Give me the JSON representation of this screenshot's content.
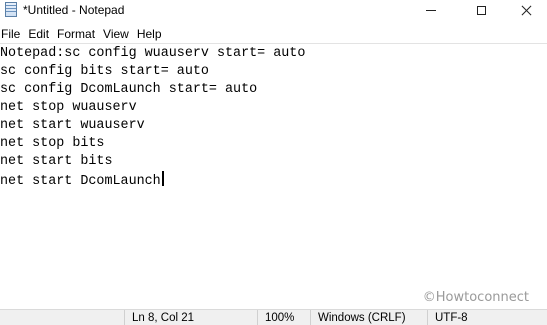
{
  "window": {
    "title": "*Untitled - Notepad",
    "app_icon": "notepad-icon"
  },
  "menu": {
    "items": [
      "File",
      "Edit",
      "Format",
      "View",
      "Help"
    ]
  },
  "editor": {
    "lines": [
      "Notepad:sc config wuauserv start= auto",
      "sc config bits start= auto",
      "sc config DcomLaunch start= auto",
      "net stop wuauserv",
      "net start wuauserv",
      "net stop bits",
      "net start bits",
      "net start DcomLaunch"
    ]
  },
  "status": {
    "position": "Ln 8, Col 21",
    "zoom": "100%",
    "line_ending": "Windows (CRLF)",
    "encoding": "UTF-8"
  },
  "watermark": "©Howtoconnect"
}
